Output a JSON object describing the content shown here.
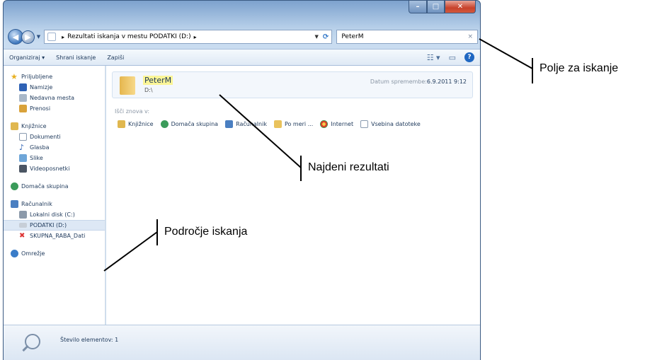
{
  "window": {
    "address_path": "Rezultati iskanja v mestu PODATKI (D:)",
    "search_value": "PeterM"
  },
  "toolbar": {
    "organize": "Organiziraj ▾",
    "save_search": "Shrani iskanje",
    "burn": "Zapiši"
  },
  "sidebar": {
    "favorites": "Priljubljene",
    "desktop": "Namizje",
    "recent": "Nedavna mesta",
    "downloads": "Prenosi",
    "libraries": "Knjižnice",
    "documents": "Dokumenti",
    "music": "Glasba",
    "pictures": "Slike",
    "videos": "Videoposnetki",
    "homegroup": "Domača skupina",
    "computer": "Računalnik",
    "local_disk": "Lokalni disk (C:)",
    "data_drive": "PODATKI (D:)",
    "shared": "SKUPNA_RABA_Dati",
    "network": "Omrežje"
  },
  "result": {
    "name": "PeterM",
    "path": "D:\\",
    "date_label": "Datum spremembe:",
    "date_value": "6.9.2011 9:12"
  },
  "search_again": {
    "label": "Išči znova v:",
    "items": [
      "Knjižnice",
      "Domača skupina",
      "Računalnik",
      "Po meri ...",
      "Internet",
      "Vsebina datoteke"
    ]
  },
  "status": {
    "text": "Število elementov: 1"
  },
  "annotations": {
    "search_field": "Polje za iskanje",
    "results": "Najdeni rezultati",
    "scope": "Področje iskanja"
  },
  "colors": {
    "frame": "#b9d1ea",
    "accent": "#1f67c2",
    "highlight": "#fbf597",
    "folder": "#e5b64e"
  }
}
